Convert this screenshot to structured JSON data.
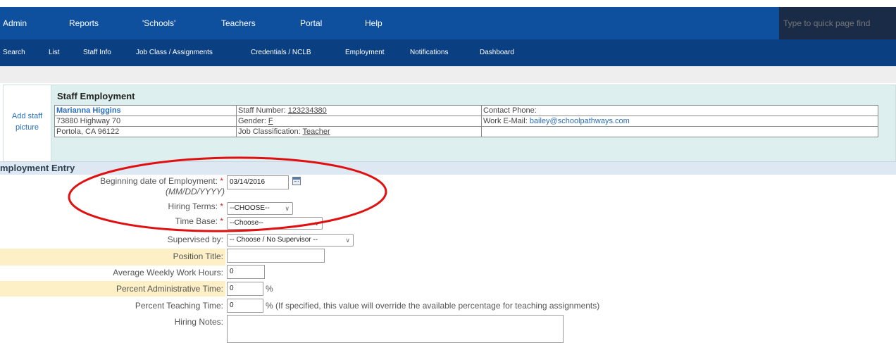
{
  "topnav": {
    "items": [
      "Admin",
      "Reports",
      "'Schools'",
      "Teachers",
      "Portal",
      "Help"
    ],
    "quickfind_placeholder": "Type to quick page find"
  },
  "subnav": {
    "items": [
      "Search",
      "List",
      "Staff Info",
      "Job Class / Assignments",
      "Credentials / NCLB",
      "Employment",
      "Notifications",
      "Dashboard"
    ]
  },
  "staff": {
    "add_picture": "Add staff picture",
    "section_title": "Staff Employment",
    "name": "Marianna Higgins",
    "address1": "73880 Highway 70",
    "address2": "Portola, CA 96122",
    "staff_number_label": "Staff Number:",
    "staff_number": "123234380",
    "gender_label": "Gender:",
    "gender": "F",
    "job_class_label": "Job Classification:",
    "job_class": "Teacher",
    "contact_phone_label": "Contact Phone:",
    "work_email_label": "Work E-Mail:",
    "work_email": "bailey@schoolpathways.com"
  },
  "entry": {
    "header": "mployment Entry",
    "begin_date_label": "Beginning date of Employment:",
    "begin_date_hint": "(MM/DD/YYYY)",
    "begin_date_value": "03/14/2016",
    "hiring_terms_label": "Hiring Terms:",
    "hiring_terms_value": "--CHOOSE--",
    "time_base_label": "Time Base:",
    "time_base_value": "--Choose--",
    "supervised_by_label": "Supervised by:",
    "supervised_by_value": "-- Choose / No Supervisor --",
    "position_title_label": "Position Title:",
    "position_title_value": "",
    "avg_hours_label": "Average Weekly Work Hours:",
    "avg_hours_value": "0",
    "pct_admin_label": "Percent Administrative Time:",
    "pct_admin_value": "0",
    "pct_admin_suffix": "%",
    "pct_teach_label": "Percent Teaching Time:",
    "pct_teach_value": "0",
    "pct_teach_suffix": "% (If specified, this value will override the available percentage for teaching assignments)",
    "hiring_notes_label": "Hiring Notes:",
    "required_mark": "*"
  },
  "colors": {
    "topnav_bg": "#0e4f9e",
    "subnav_bg": "#0a3f82",
    "highlight_row": "#fdefc6",
    "annotation_circle": "#e01010"
  },
  "icons": {
    "date_picker": "calendar-icon",
    "dropdown": "chevron-down-icon"
  }
}
